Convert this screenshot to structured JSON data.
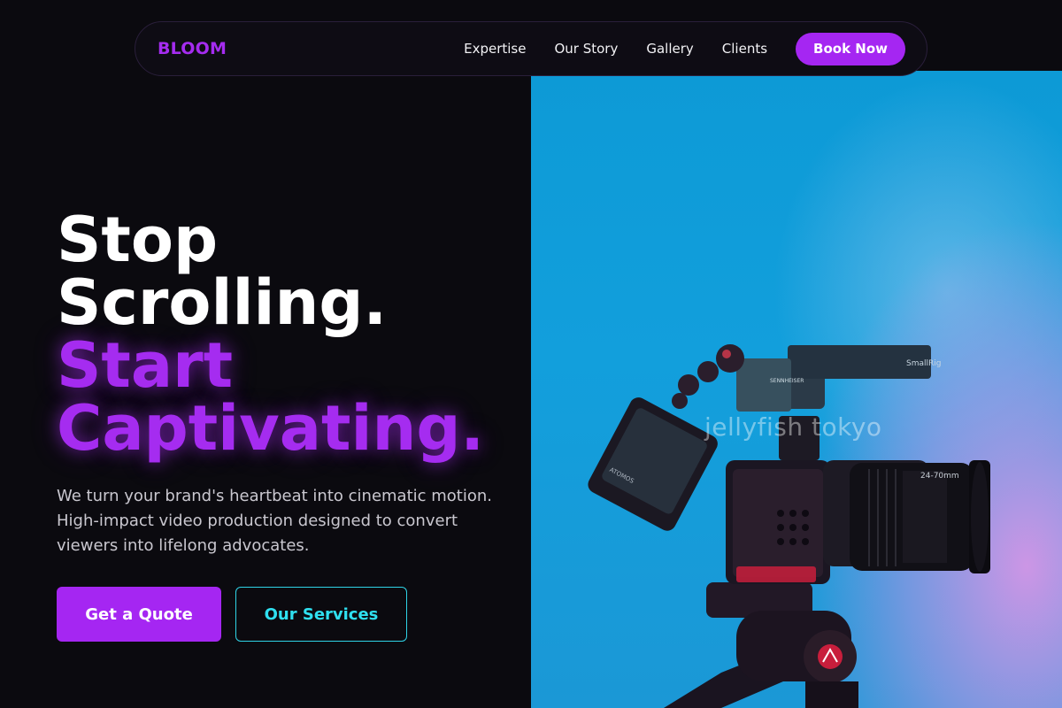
{
  "brand": {
    "logo": "BLOOM"
  },
  "nav": {
    "links": [
      "Expertise",
      "Our Story",
      "Gallery",
      "Clients"
    ],
    "cta": "Book Now"
  },
  "hero": {
    "headline_white": [
      "Stop",
      "Scrolling."
    ],
    "headline_accent": [
      "Start",
      "Captivating."
    ],
    "subtext": "We turn your brand's heartbeat into cinematic motion. High-impact video production designed to convert viewers into lifelong advocates.",
    "primary_cta": "Get a Quote",
    "secondary_cta": "Our Services"
  },
  "photo": {
    "watermark": "jellyfish tokyo",
    "mic_label": "SENNHEISER",
    "grip_label": "SmallRig",
    "monitor_label": "ATOMOS",
    "lens_label": "24-70mm"
  },
  "colors": {
    "background": "#0b0a0f",
    "accent_purple": "#a526f2",
    "accent_cyan": "#2fe0f0",
    "photo_blue": "#129fdc",
    "photo_pink": "#d696e6"
  }
}
